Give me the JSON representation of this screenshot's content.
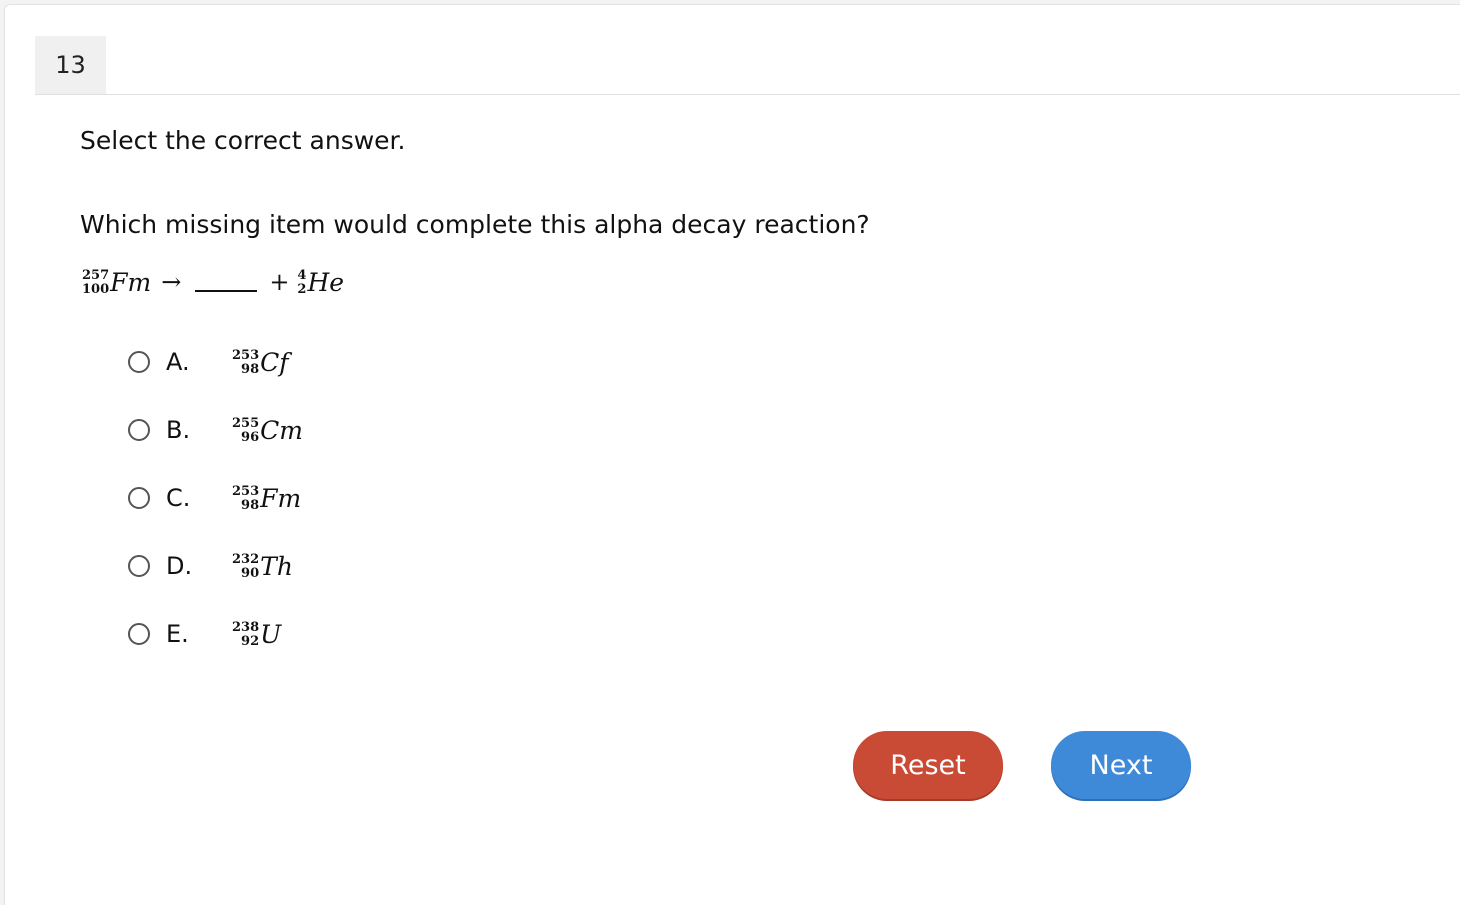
{
  "question_number": "13",
  "instruction": "Select the correct answer.",
  "question": "Which missing item would complete this alpha decay reaction?",
  "equation": {
    "reactant": {
      "mass": "257",
      "atomic": "100",
      "symbol": "Fm"
    },
    "arrow": "→",
    "plus": "+",
    "product": {
      "mass": "4",
      "atomic": "2",
      "symbol": "He"
    }
  },
  "options": [
    {
      "letter": "A.",
      "mass": "253",
      "atomic": "98",
      "symbol": "Cf"
    },
    {
      "letter": "B.",
      "mass": "255",
      "atomic": "96",
      "symbol": "Cm"
    },
    {
      "letter": "C.",
      "mass": "253",
      "atomic": "98",
      "symbol": "Fm"
    },
    {
      "letter": "D.",
      "mass": "232",
      "atomic": "90",
      "symbol": "Th"
    },
    {
      "letter": "E.",
      "mass": "238",
      "atomic": "92",
      "symbol": "U"
    }
  ],
  "buttons": {
    "reset": "Reset",
    "next": "Next"
  },
  "colors": {
    "reset": "#c94a35",
    "next": "#3e8ad9"
  }
}
